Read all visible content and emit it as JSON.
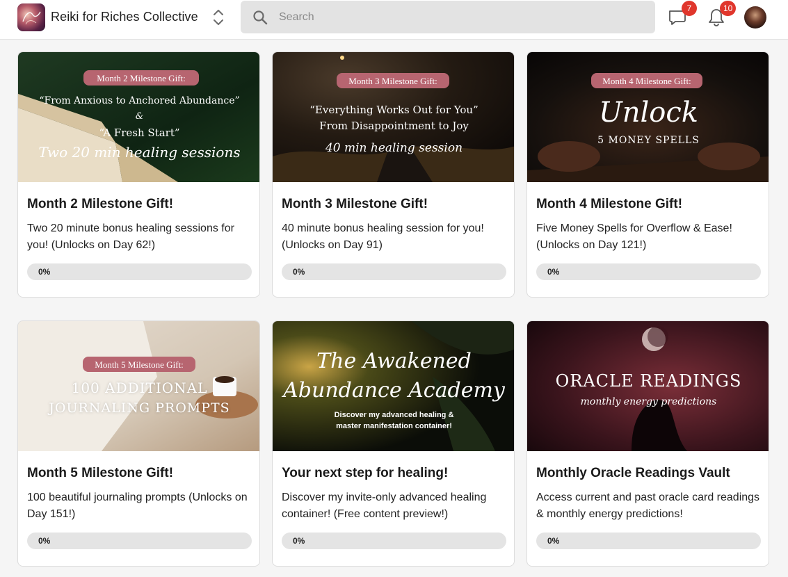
{
  "app": {
    "group_name": "Reiki for Riches Collective"
  },
  "search": {
    "placeholder": "Search"
  },
  "notifications": {
    "chat_count": "7",
    "bell_count": "10"
  },
  "colors": {
    "badge": "#e0362c",
    "pill": "#b76570"
  },
  "cards": [
    {
      "title": "Month 2 Milestone Gift!",
      "description": "Two 20 minute bonus healing sessions for you! (Unlocks on Day 62!)",
      "progress_label": "0%",
      "progress": 0,
      "cover": {
        "pill": "Month 2 Milestone Gift:",
        "line1": "“From Anxious to Anchored Abundance”",
        "line2": "&",
        "line3": "“A Fresh Start”",
        "script": "Two 20 min healing sessions"
      }
    },
    {
      "title": "Month 3 Milestone Gift!",
      "description": "40 minute bonus healing session for you! (Unlocks on Day 91)",
      "progress_label": "0%",
      "progress": 0,
      "cover": {
        "pill": "Month 3 Milestone Gift:",
        "line1": "“Everything Works Out for You”",
        "line2": "From Disappointment to Joy",
        "script": "40 min healing session"
      }
    },
    {
      "title": "Month 4 Milestone Gift!",
      "description": "Five Money Spells for Overflow & Ease! (Unlocks on Day 121!)",
      "progress_label": "0%",
      "progress": 0,
      "cover": {
        "pill": "Month 4 Milestone Gift:",
        "script": "Unlock",
        "line1": "5 MONEY SPELLS"
      }
    },
    {
      "title": "Month 5 Milestone Gift!",
      "description": "100 beautiful journaling prompts (Unlocks on Day 151!)",
      "progress_label": "0%",
      "progress": 0,
      "cover": {
        "pill": "Month 5 Milestone Gift:",
        "line1": "100 ADDITIONAL",
        "line2": "JOURNALING PROMPTS"
      }
    },
    {
      "title": "Your next step for healing!",
      "description": "Discover my invite-only advanced healing container! (Free content preview!)",
      "progress_label": "0%",
      "progress": 0,
      "cover": {
        "script1": "The Awakened",
        "script2": "Abundance Academy",
        "line1": "Discover my advanced healing &",
        "line2": "master manifestation container!"
      }
    },
    {
      "title": "Monthly Oracle Readings Vault",
      "description": "Access current and past oracle card readings & monthly energy predictions!",
      "progress_label": "0%",
      "progress": 0,
      "cover": {
        "line1": "ORACLE READINGS",
        "script": "monthly energy predictions"
      }
    }
  ]
}
